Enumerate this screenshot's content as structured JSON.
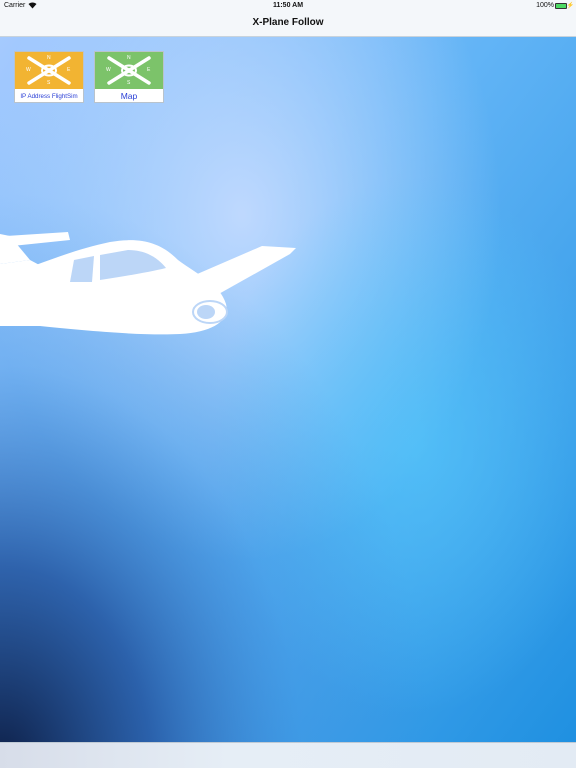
{
  "status_bar": {
    "carrier": "Carrier",
    "time": "11:50 AM",
    "battery_percent": "100%"
  },
  "nav_bar": {
    "title": "X-Plane Follow"
  },
  "tiles": [
    {
      "label": "IP Address FlightSim",
      "icon": "compass-icon",
      "color": "#f2b432",
      "compass": {
        "n": "N",
        "s": "S",
        "e": "E",
        "w": "W"
      }
    },
    {
      "label": "Map",
      "icon": "compass-icon",
      "color": "#7cc36a",
      "compass": {
        "n": "N",
        "s": "S",
        "e": "E",
        "w": "W"
      }
    }
  ],
  "background": {
    "icon": "airplane-icon"
  },
  "colors": {
    "bar": "#f4f7fa",
    "link_text": "#2a3fd6",
    "sky_light": "#bcd8ff",
    "sky_dark": "#0f2550"
  }
}
